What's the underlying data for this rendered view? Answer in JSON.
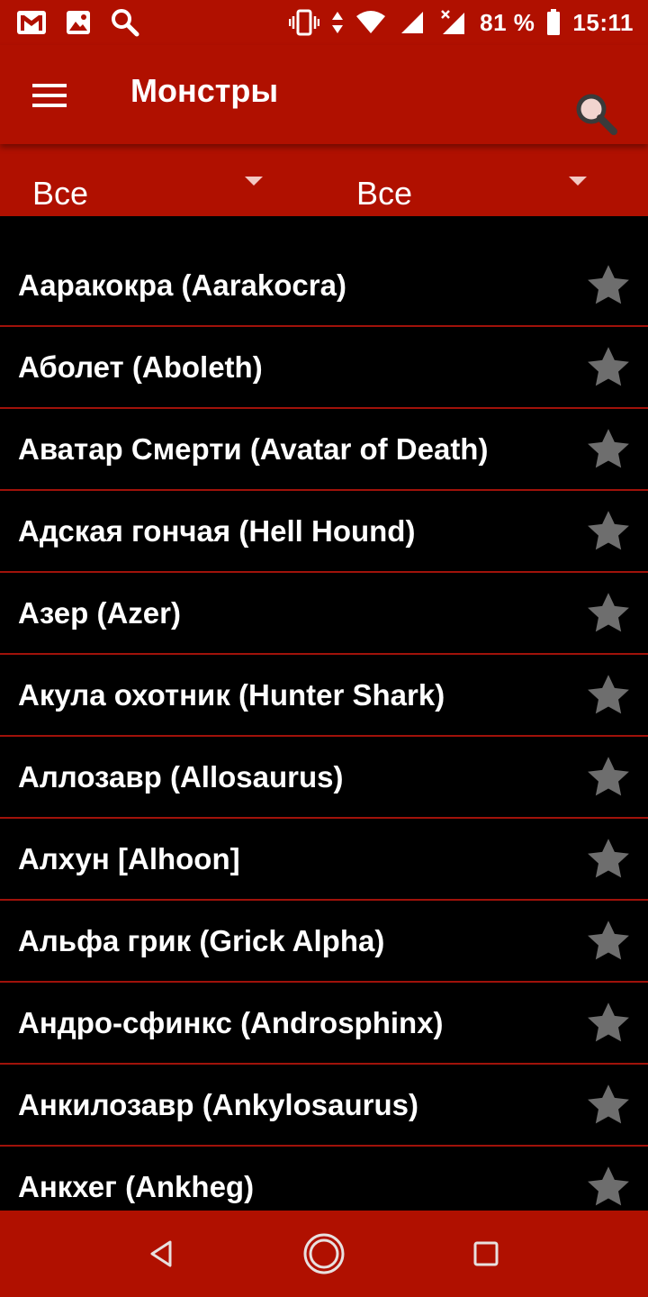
{
  "status_bar": {
    "left_icons": [
      "gmail-icon",
      "image-icon",
      "search-icon"
    ],
    "right_icons": [
      "vibrate-icon",
      "data-arrows-icon",
      "wifi-icon",
      "signal-icon",
      "signal-no-service-icon",
      "battery-icon"
    ],
    "battery": "81 %",
    "time": "15:11"
  },
  "app_bar": {
    "title": "Монстры",
    "menu_icon": "hamburger-menu-icon",
    "search_icon": "search-icon"
  },
  "filters": [
    {
      "value": "Все",
      "icon": "dropdown-arrow-icon"
    },
    {
      "value": "Все",
      "icon": "dropdown-arrow-icon"
    }
  ],
  "monsters": [
    {
      "name": "Ааракокра (Aarakocra)",
      "favorite_icon": "star-icon"
    },
    {
      "name": "Аболет (Aboleth)",
      "favorite_icon": "star-icon"
    },
    {
      "name": "Аватар Смерти (Avatar of Death)",
      "favorite_icon": "star-icon"
    },
    {
      "name": "Адская гончая (Hell Hound)",
      "favorite_icon": "star-icon"
    },
    {
      "name": "Азер (Azer)",
      "favorite_icon": "star-icon"
    },
    {
      "name": "Акула охотник (Hunter Shark)",
      "favorite_icon": "star-icon"
    },
    {
      "name": "Аллозавр (Allosaurus)",
      "favorite_icon": "star-icon"
    },
    {
      "name": "Алхун [Alhoon]",
      "favorite_icon": "star-icon"
    },
    {
      "name": "Альфа грик (Grick Alpha)",
      "favorite_icon": "star-icon"
    },
    {
      "name": "Андро-сфинкс (Androsphinx)",
      "favorite_icon": "star-icon"
    },
    {
      "name": "Анкилозавр (Ankylosaurus)",
      "favorite_icon": "star-icon"
    },
    {
      "name": "Анкхег (Ankheg)",
      "favorite_icon": "star-icon"
    }
  ],
  "nav_bar": {
    "icons": [
      "back-icon",
      "home-icon",
      "recents-icon"
    ]
  },
  "colors": {
    "primary": "#b01000",
    "background": "#000000",
    "divider": "#a0120a",
    "star": "#6e6e6e",
    "text": "#ffffff"
  }
}
